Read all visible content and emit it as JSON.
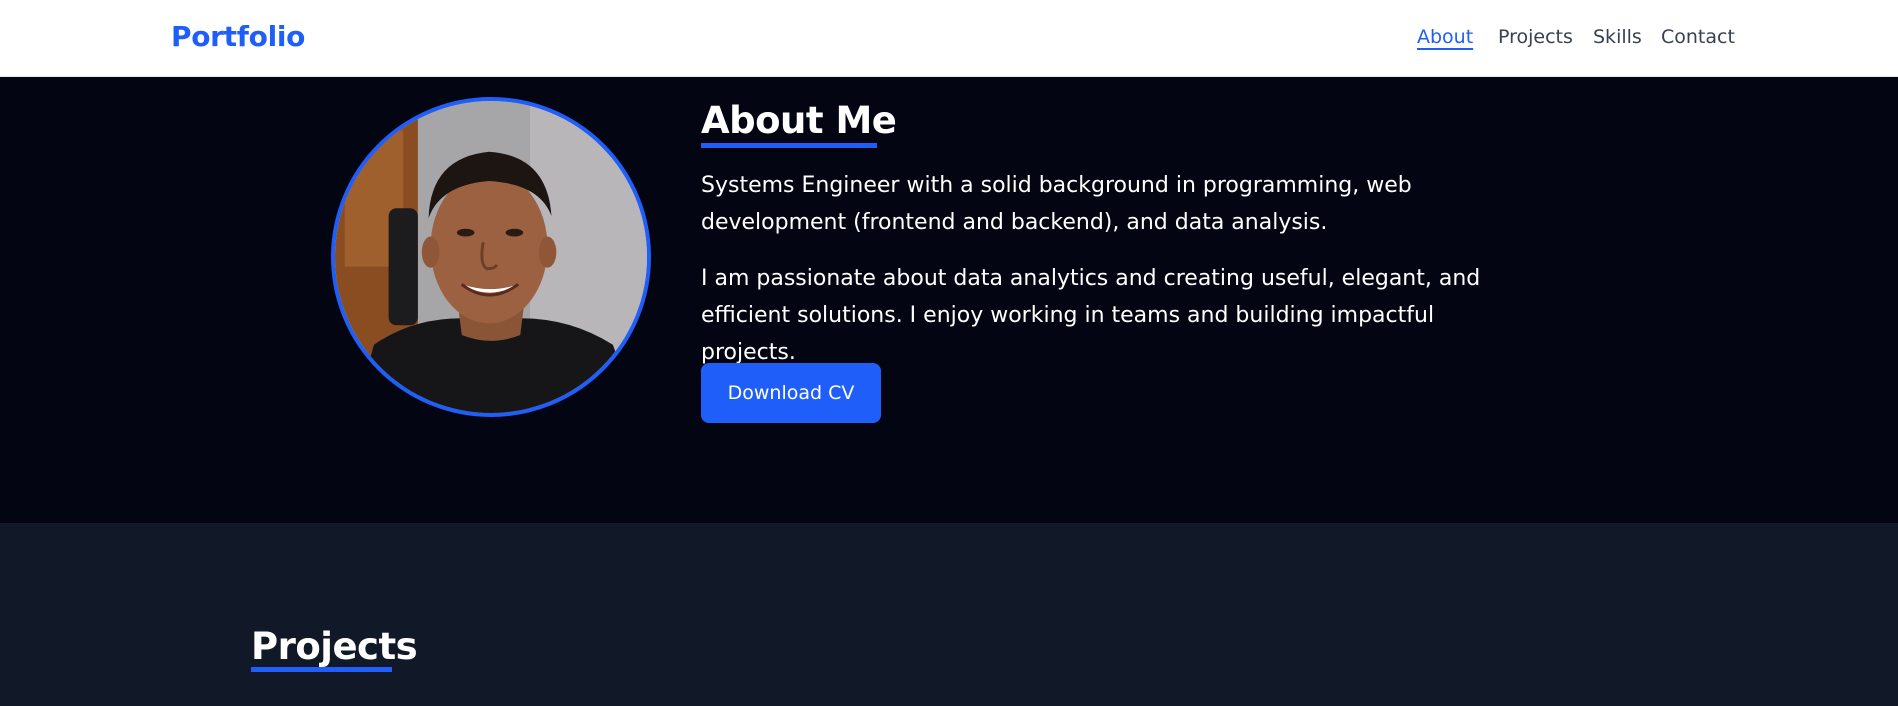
{
  "header": {
    "brand": "Portfolio",
    "nav": [
      {
        "label": "About",
        "active": true
      },
      {
        "label": "Projects",
        "active": false
      },
      {
        "label": "Skills",
        "active": false
      },
      {
        "label": "Contact",
        "active": false
      }
    ]
  },
  "about": {
    "title": "About Me",
    "paragraphs": [
      "Systems Engineer with a solid background in programming, web development (frontend and backend), and data analysis.",
      "I am passionate about data analytics and creating useful, elegant, and efficient solutions. I enjoy working in teams and building impactful projects."
    ],
    "cv_button": "Download CV"
  },
  "projects": {
    "title": "Projects"
  },
  "colors": {
    "accent": "#1f5ef8",
    "header_bg": "#ffffff",
    "about_bg": "#030612",
    "projects_bg": "#111827",
    "text_light": "#ffffff",
    "nav_text": "#374151"
  },
  "icons": {
    "avatar": "profile-photo"
  }
}
